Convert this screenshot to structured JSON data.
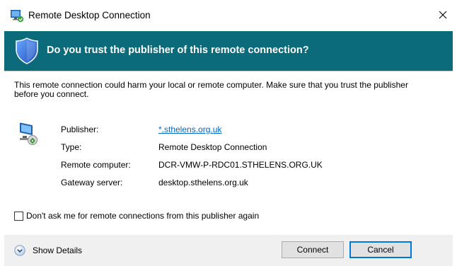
{
  "window": {
    "title": "Remote Desktop Connection",
    "close_glyph": "✕"
  },
  "banner": {
    "question": "Do you trust the publisher of this remote connection?"
  },
  "warning_text": "This remote connection could harm your local or remote computer. Make sure that you trust the publisher before you connect.",
  "details": [
    {
      "label": "Publisher:",
      "value": "*.sthelens.org.uk",
      "is_link": true
    },
    {
      "label": "Type:",
      "value": "Remote Desktop Connection",
      "is_link": false
    },
    {
      "label": "Remote computer:",
      "value": "DCR-VMW-P-RDC01.STHELENS.ORG.UK",
      "is_link": false
    },
    {
      "label": "Gateway server:",
      "value": "desktop.sthelens.org.uk",
      "is_link": false
    }
  ],
  "checkbox": {
    "label": "Don't ask me for remote connections from this publisher again",
    "checked": false
  },
  "footer": {
    "show_details_label": "Show Details",
    "connect_label": "Connect",
    "cancel_label": "Cancel"
  },
  "colors": {
    "banner": "#0c6b7a",
    "footer": "#f0f0f0",
    "link": "#0066cc",
    "focus": "#0078d7"
  },
  "icons": {
    "app": "remote-desktop-icon",
    "shield": "shield-icon",
    "computer": "computer-icon",
    "expand": "chevron-down-circle-icon",
    "close": "close-icon"
  }
}
